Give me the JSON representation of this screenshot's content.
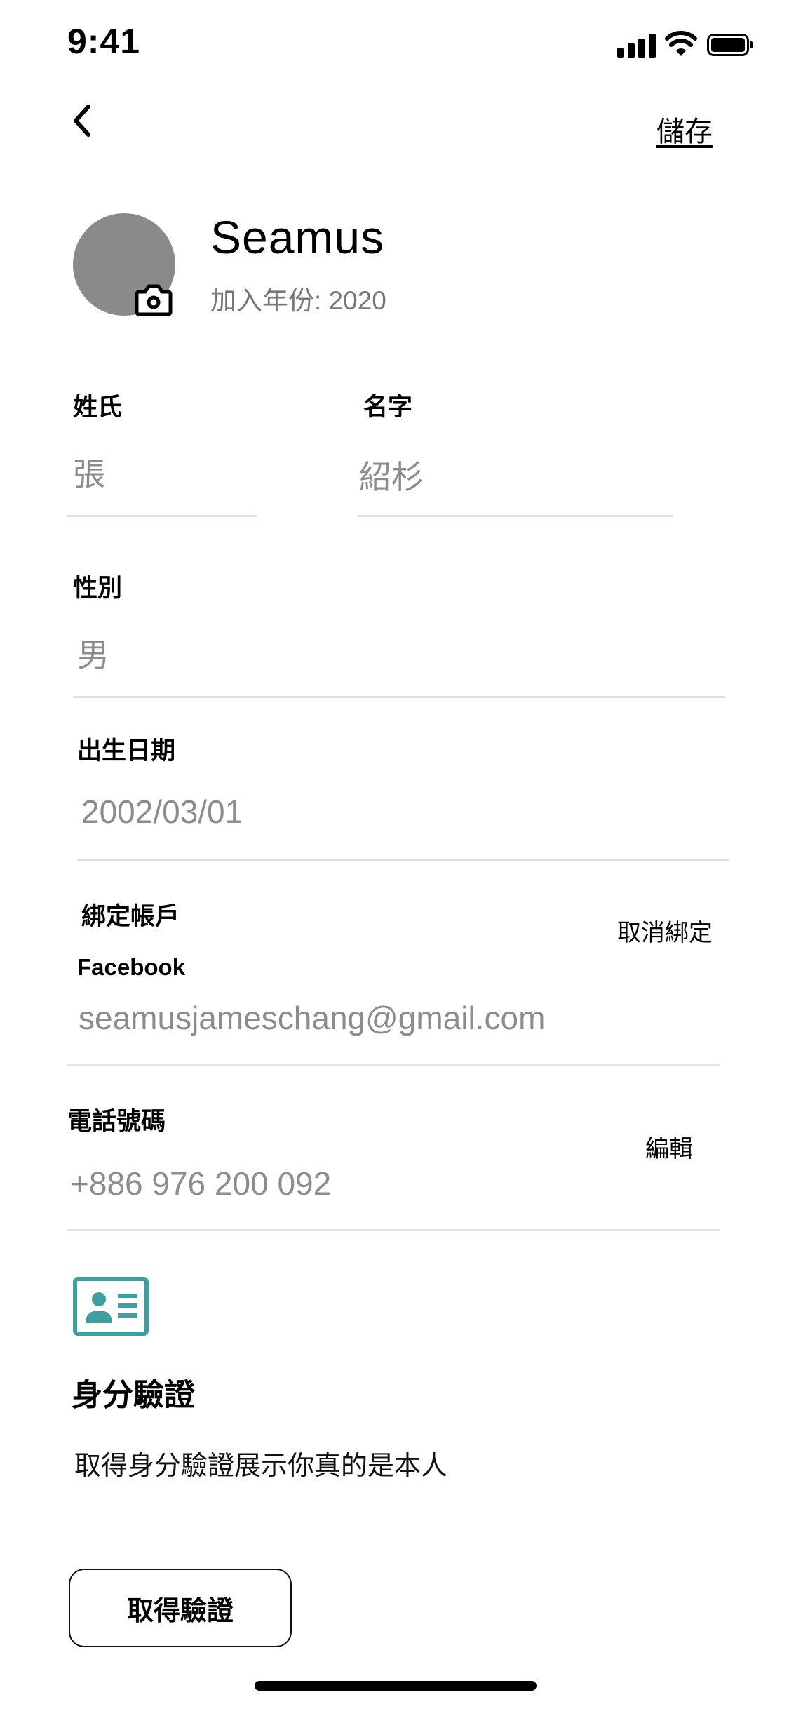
{
  "status_bar": {
    "time": "9:41"
  },
  "nav": {
    "save_label": "儲存"
  },
  "profile": {
    "name": "Seamus",
    "joined": "加入年份: 2020"
  },
  "fields": {
    "last_name": {
      "label": "姓氏",
      "value": "張"
    },
    "first_name": {
      "label": "名字",
      "value": "紹杉"
    },
    "gender": {
      "label": "性別",
      "value": "男"
    },
    "birthday": {
      "label": "出生日期",
      "value": "2002/03/01"
    },
    "linked_account": {
      "label": "綁定帳戶",
      "action": "取消綁定",
      "provider": "Facebook",
      "email": "seamusjameschang@gmail.com"
    },
    "phone": {
      "label": "電話號碼",
      "action": "編輯",
      "value": "+886 976 200 092"
    }
  },
  "verification": {
    "icon": "id-card-icon",
    "title": "身分驗證",
    "description": "取得身分驗證展示你真的是本人",
    "button_label": "取得驗證",
    "icon_color": "#3f9ea0"
  }
}
